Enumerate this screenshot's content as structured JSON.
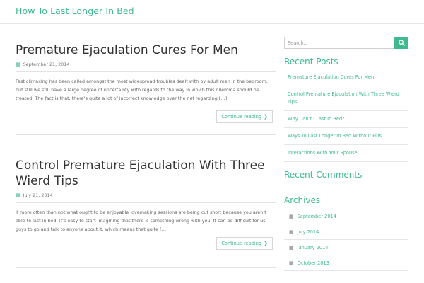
{
  "site": {
    "title": "How To Last Longer In Bed"
  },
  "posts": [
    {
      "title": "Premature Ejaculation Cures For Men",
      "date": "September 21, 2014",
      "excerpt": "Fast climaxing has been called amongst the most widespread troubles dealt with by adult men in the bedroom, but still we still have a large degree of uncertainty with regards to the way in which this dilemma should be treated. The fact is that, there’s quite a lot of incorrect knowledge over the net regarding […]",
      "continue_label": "Continue reading"
    },
    {
      "title": "Control Premature Ejaculation With Three Wierd Tips",
      "date": "July 21, 2014",
      "excerpt": "If more often than not what ought to be enjoyable lovemaking sessions are being cut short because you aren’t able to last in bed, it’s easy to start imagining that there is something wrong with you. It can be difficult for us guys to go and talk to anyone about it, which means that quite […]",
      "continue_label": "Continue reading"
    }
  ],
  "sidebar": {
    "search_placeholder": "Search...",
    "recent_posts_title": "Recent Posts",
    "recent_posts": [
      "Premature Ejaculation Cures For Men",
      "Control Premature Ejaculation With Three Wierd Tips",
      "Why Can’t I Last In Bed?",
      "Ways To Last Longer In Bed Without Pills",
      "Interactions With Your Spouse"
    ],
    "recent_comments_title": "Recent Comments",
    "archives_title": "Archives",
    "archives": [
      "September 2014",
      "July 2014",
      "January 2014",
      "October 2013"
    ]
  },
  "icons": {
    "calendar": "calendar-icon",
    "search": "search-icon",
    "arrow": "chevron-right-icon"
  },
  "colors": {
    "accent": "#3fba8f"
  }
}
